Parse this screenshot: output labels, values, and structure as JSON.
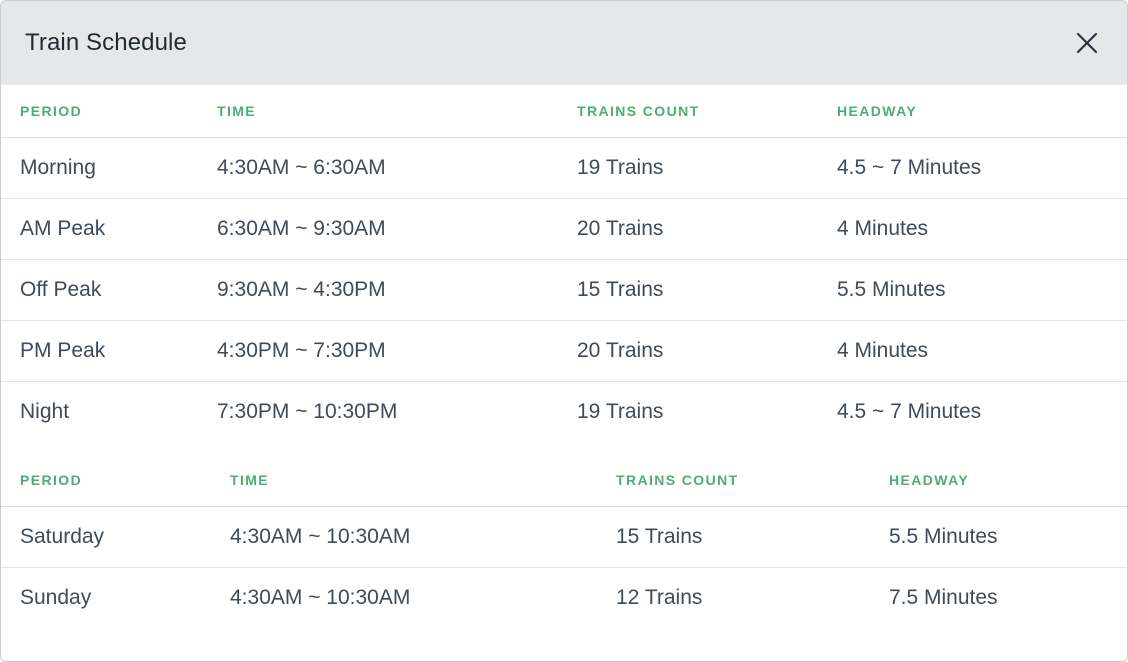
{
  "dialog": {
    "title": "Train Schedule",
    "close_icon": "close-icon"
  },
  "colors": {
    "header_bg": "#e5e7ea",
    "column_header": "#4caf6e",
    "body_text": "#3f4a5a",
    "title_text": "#1f2a37"
  },
  "weekday": {
    "headers": [
      "PERIOD",
      "TIME",
      "TRAINS COUNT",
      "HEADWAY"
    ],
    "rows": [
      [
        "Morning",
        "4:30AM ~ 6:30AM",
        "19 Trains",
        "4.5 ~ 7 Minutes"
      ],
      [
        "AM Peak",
        "6:30AM ~ 9:30AM",
        "20 Trains",
        "4 Minutes"
      ],
      [
        "Off Peak",
        "9:30AM ~ 4:30PM",
        "15 Trains",
        "5.5 Minutes"
      ],
      [
        "PM Peak",
        "4:30PM ~ 7:30PM",
        "20 Trains",
        "4 Minutes"
      ],
      [
        "Night",
        "7:30PM ~ 10:30PM",
        "19 Trains",
        "4.5 ~ 7 Minutes"
      ]
    ]
  },
  "weekend": {
    "headers": [
      "PERIOD",
      "TIME",
      "TRAINS COUNT",
      "HEADWAY"
    ],
    "rows": [
      [
        "Saturday",
        "4:30AM ~ 10:30AM",
        "15 Trains",
        "5.5 Minutes"
      ],
      [
        "Sunday",
        "4:30AM ~ 10:30AM",
        "12 Trains",
        "7.5 Minutes"
      ]
    ]
  }
}
